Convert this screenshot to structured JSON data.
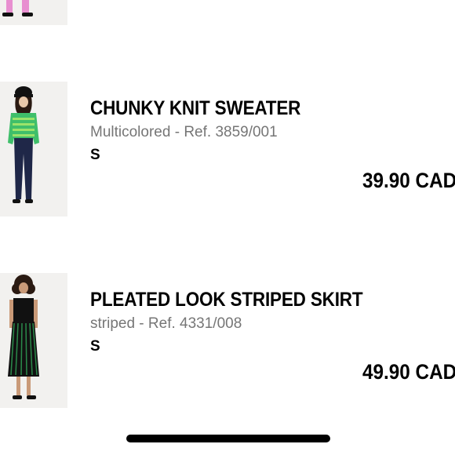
{
  "cart": {
    "items": [
      {
        "name": "",
        "details": "",
        "size": "",
        "price": ""
      },
      {
        "name": "CHUNKY KNIT SWEATER",
        "details": "Multicolored - Ref. 3859/001",
        "size": "S",
        "price": "39.90 CAD"
      },
      {
        "name": "PLEATED LOOK STRIPED SKIRT",
        "details": "striped - Ref. 4331/008",
        "size": "S",
        "price": "49.90 CAD"
      }
    ]
  },
  "colors": {
    "text": "#000000",
    "muted": "#767676",
    "thumb_bg": "#f2f1ef",
    "sweater_stripe_a": "#3fbf6a",
    "sweater_stripe_b": "#9be36a",
    "pants": "#1f2748",
    "skirt_stripe": "#2a8a4a",
    "pink_pants": "#e88fd0"
  }
}
